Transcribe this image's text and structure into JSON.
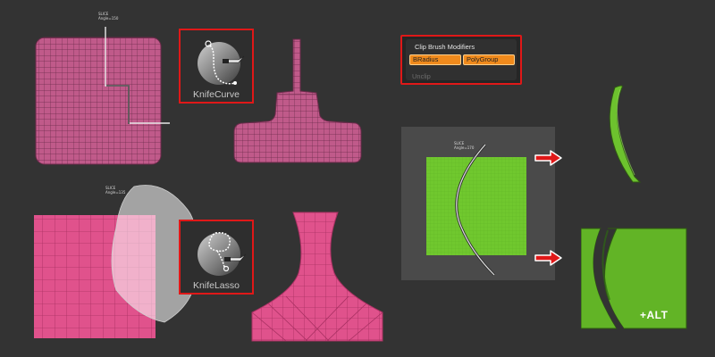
{
  "slice_labels": {
    "slice1_line1": "SLICE",
    "slice1_line2": "Angle=150",
    "slice2_line1": "SLICE",
    "slice2_line2": "Angle=135",
    "slice3_line1": "SLICE",
    "slice3_line2": "Angle=170"
  },
  "brushes": {
    "knife_curve": {
      "label": "KnifeCurve",
      "icon": "knife-curve-brush-icon"
    },
    "knife_lasso": {
      "label": "KnifeLasso",
      "icon": "knife-lasso-brush-icon"
    }
  },
  "modifiers": {
    "title": "Clip Brush Modifiers",
    "bradius": "BRadius",
    "polygroup": "PolyGroup",
    "unclip": "Unclip"
  },
  "alt_label": "+ALT",
  "colors": {
    "background": "#333333",
    "mesh_mauve": "#c05a8a",
    "mesh_pink": "#e0528c",
    "mesh_green": "#6dc22e",
    "highlight_red": "#e01818",
    "button_orange": "#f08a1c"
  }
}
